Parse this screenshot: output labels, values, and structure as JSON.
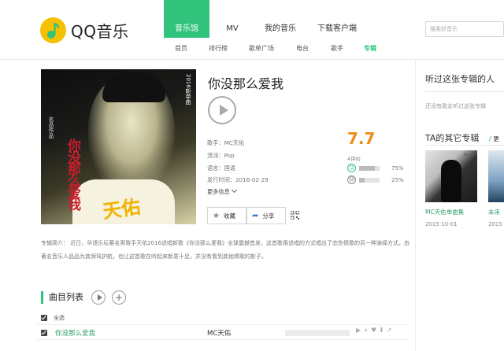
{
  "brand": {
    "logo_text": "QQ音乐",
    "accent": "#31c27c",
    "logo_color": "#f5c000"
  },
  "main_nav": [
    {
      "label": "音乐馆",
      "active": true
    },
    {
      "label": "MV"
    },
    {
      "label": "我的音乐"
    },
    {
      "label": "下载客户端"
    }
  ],
  "search": {
    "placeholder": "搜索好音乐"
  },
  "sub_nav": [
    {
      "label": "首页"
    },
    {
      "label": "排行榜"
    },
    {
      "label": "歌单广场"
    },
    {
      "label": "电台"
    },
    {
      "label": "歌手"
    },
    {
      "label": "专辑",
      "active": true
    }
  ],
  "album": {
    "title": "你没那么爱我",
    "cover": {
      "year_text": "2016新单曲",
      "studio_text": "名品作品",
      "red_title": "你没那么爱我",
      "signature": "天佑"
    },
    "meta": [
      {
        "label": "歌手：",
        "value": "MC天佑"
      },
      {
        "label": "流派：",
        "value": "Pop"
      },
      {
        "label": "语言：",
        "value": "国语"
      },
      {
        "label": "发行时间：",
        "value": "2016-02-29"
      }
    ],
    "more_info": "更多信息",
    "rating": "7.7",
    "rating_count": "4评价",
    "good_pct": "75%",
    "good_value": 0.75,
    "bad_pct": "25%",
    "bad_value": 0.25,
    "fav_label": "收藏",
    "share_label": "分享",
    "description": "专辑简介：  近日，华语乐坛著名男歌手天佑2016说唱新歌《你没那么爱我》全球震撼首发，这首歌用说唱的方式唱出了恋伤情歌的另一种演绎方式，由著名音乐人品品为其保驾护航，也让这首歌在听起来新意十足，并没有看到其他情歌的影子。"
  },
  "tracklist": {
    "title": "曲目列表",
    "select_all": "全选",
    "songs": [
      {
        "name": "你没那么爱我",
        "artist": "MC天佑"
      }
    ]
  },
  "sidebar": {
    "listeners_title": "听过这张专辑的人",
    "listeners_empty": "还没有歌友听过这张专辑",
    "other_albums_title": "TA的其它专辑",
    "more_label": "更",
    "albums": [
      {
        "name": "MC天佑单曲集",
        "date": "2015-10-01",
        "thumb_label": "MC天佑"
      },
      {
        "name": "未来",
        "date": "2015"
      }
    ]
  }
}
